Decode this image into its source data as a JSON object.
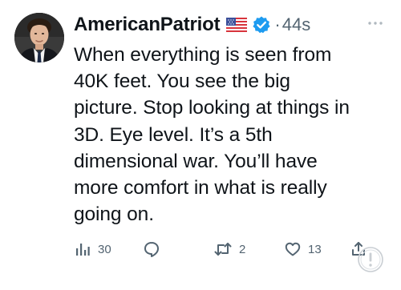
{
  "tweet": {
    "author": {
      "display_name": "AmericanPatriot",
      "flag_icon": "us-flag-icon",
      "verified_icon": "verified-badge-icon",
      "verified_color": "#1d9bf0"
    },
    "separator": "·",
    "time": "44s",
    "more_icon": "more-horizontal-icon",
    "text": "When everything is seen from\n40K feet. You see the big\npicture. Stop looking at things in\n3D. Eye level. It’s a 5th\ndimensional war. You’ll have\nmore comfort in what is really\ngoing on.",
    "actions": {
      "views": {
        "icon": "views-chart-icon",
        "count": "30"
      },
      "reply": {
        "icon": "reply-bubble-icon"
      },
      "repost": {
        "icon": "repost-icon",
        "count": "2"
      },
      "like": {
        "icon": "heart-icon",
        "count": "13"
      },
      "share": {
        "icon": "share-icon"
      }
    }
  },
  "colors": {
    "text_primary": "#0f1419",
    "text_secondary": "#536471",
    "background": "#ffffff"
  }
}
